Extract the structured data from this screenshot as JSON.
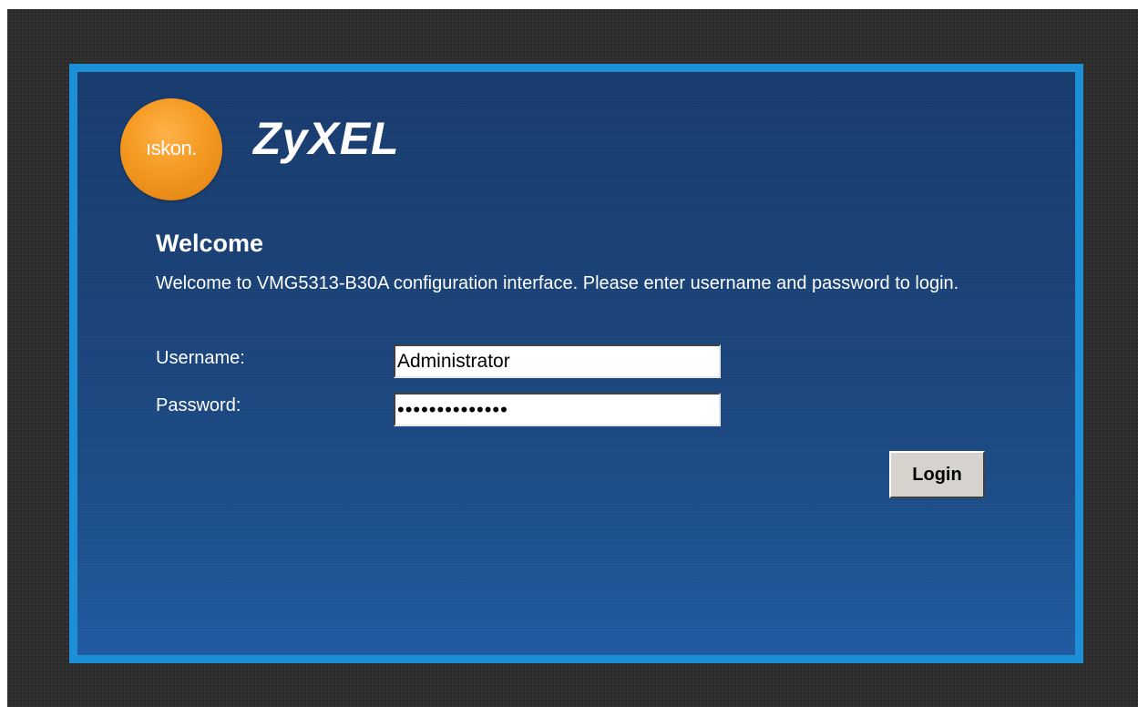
{
  "brand": {
    "isp_logo_text": "ıskon.",
    "vendor_logo_text": "ZyXEL",
    "isp_color": "#f59a22",
    "panel_color": "#1a4277",
    "frame_color": "#1d8fd6"
  },
  "welcome": {
    "title": "Welcome",
    "message": "Welcome to VMG5313-B30A configuration interface. Please enter username and password to login."
  },
  "form": {
    "username_label": "Username:",
    "username_value": "Administrator",
    "password_label": "Password:",
    "password_value": "••••••••••••••",
    "login_label": "Login"
  }
}
